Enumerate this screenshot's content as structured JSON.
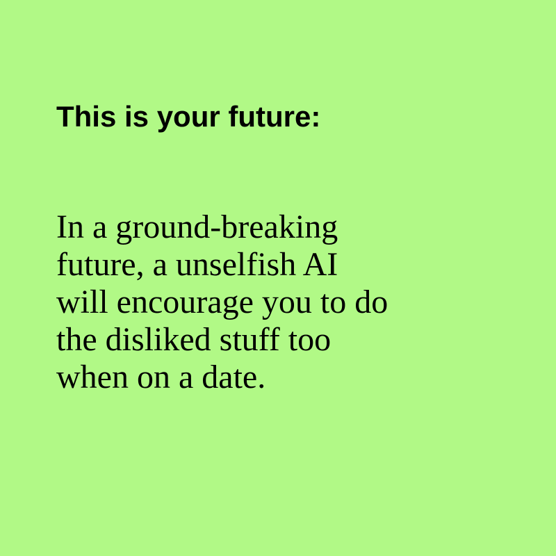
{
  "colors": {
    "background": "#b1f986",
    "text": "#000000"
  },
  "heading": "This is your future:",
  "body_lines": [
    "In a ground-breaking",
    "future, a unselfish AI",
    "will encourage you to do",
    "the disliked stuff too",
    "when on a date."
  ]
}
